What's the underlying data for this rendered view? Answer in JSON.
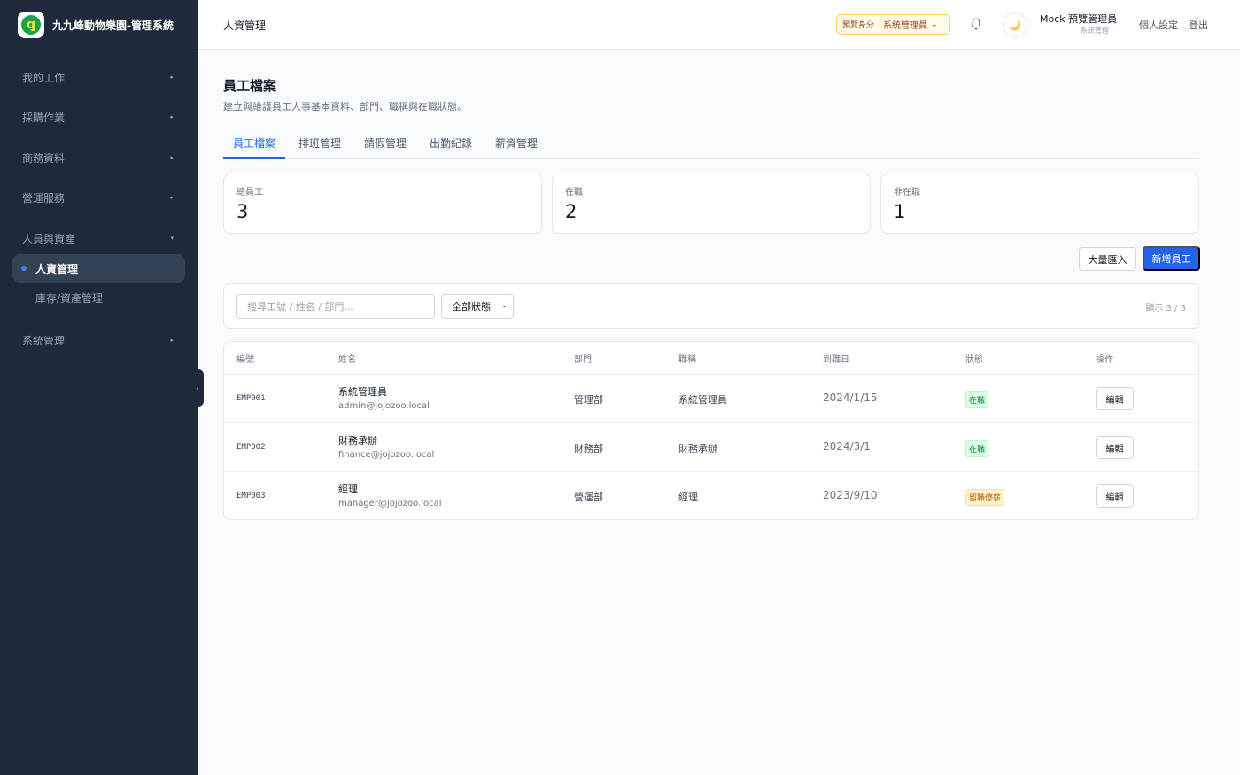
{
  "app": {
    "title": "九九峰動物樂園-管理系統",
    "logo_glyph": "ꝗ"
  },
  "sidebar": {
    "groups": [
      {
        "label": "我的工作",
        "chevron": "▸"
      },
      {
        "label": "採購作業",
        "chevron": "▸"
      },
      {
        "label": "商務資料",
        "chevron": "▸"
      },
      {
        "label": "營運服務",
        "chevron": "▸"
      },
      {
        "label": "人員與資產",
        "chevron": "▾"
      },
      {
        "label": "系統管理",
        "chevron": "▸"
      }
    ],
    "active_item": "人資管理",
    "sub_item": "庫存/資產管理",
    "collapse_glyph": "‹"
  },
  "header": {
    "breadcrumb": "人資管理",
    "preview_label": "預覽身分",
    "preview_value": "系統管理員",
    "preview_chevron": "⌄",
    "theme_glyph": "🌙",
    "user_name": "Mock 預覽管理員",
    "user_role": "系統管理",
    "settings_link": "個人設定",
    "logout_link": "登出"
  },
  "page": {
    "title": "員工檔案",
    "description": "建立與維護員工人事基本資料、部門、職稱與在職狀態。"
  },
  "tabs": [
    "員工檔案",
    "排班管理",
    "請假管理",
    "出勤紀錄",
    "薪資管理"
  ],
  "stats": [
    {
      "label": "總員工",
      "value": "3"
    },
    {
      "label": "在職",
      "value": "2"
    },
    {
      "label": "非在職",
      "value": "1"
    }
  ],
  "actions": {
    "import_label": "大量匯入",
    "add_label": "新增員工"
  },
  "filter": {
    "search_placeholder": "搜尋工號 / 姓名 / 部門...",
    "status_select": "全部狀態",
    "select_chevron": "⌄",
    "count_text": "顯示 3 / 3"
  },
  "table": {
    "headers": [
      "編號",
      "姓名",
      "部門",
      "職稱",
      "到職日",
      "狀態",
      "操作"
    ],
    "rows": [
      {
        "id": "EMP001",
        "name": "系統管理員",
        "email": "admin@jojozoo.local",
        "dept": "管理部",
        "title": "系統管理員",
        "date": "2024/1/15",
        "status": "在職",
        "action": "編輯"
      },
      {
        "id": "EMP002",
        "name": "財務承辦",
        "email": "finance@jojozoo.local",
        "dept": "財務部",
        "title": "財務承辦",
        "date": "2024/3/1",
        "status": "在職",
        "action": "編輯"
      },
      {
        "id": "EMP003",
        "name": "經理",
        "email": "manager@jojozoo.local",
        "dept": "營運部",
        "title": "經理",
        "date": "2023/9/10",
        "status": "留職停薪",
        "action": "編輯"
      }
    ]
  },
  "colors": {
    "sidebar_bg": "#1e293b",
    "accent": "#2563eb",
    "status_active": "#15803d",
    "status_leave": "#b45309"
  }
}
